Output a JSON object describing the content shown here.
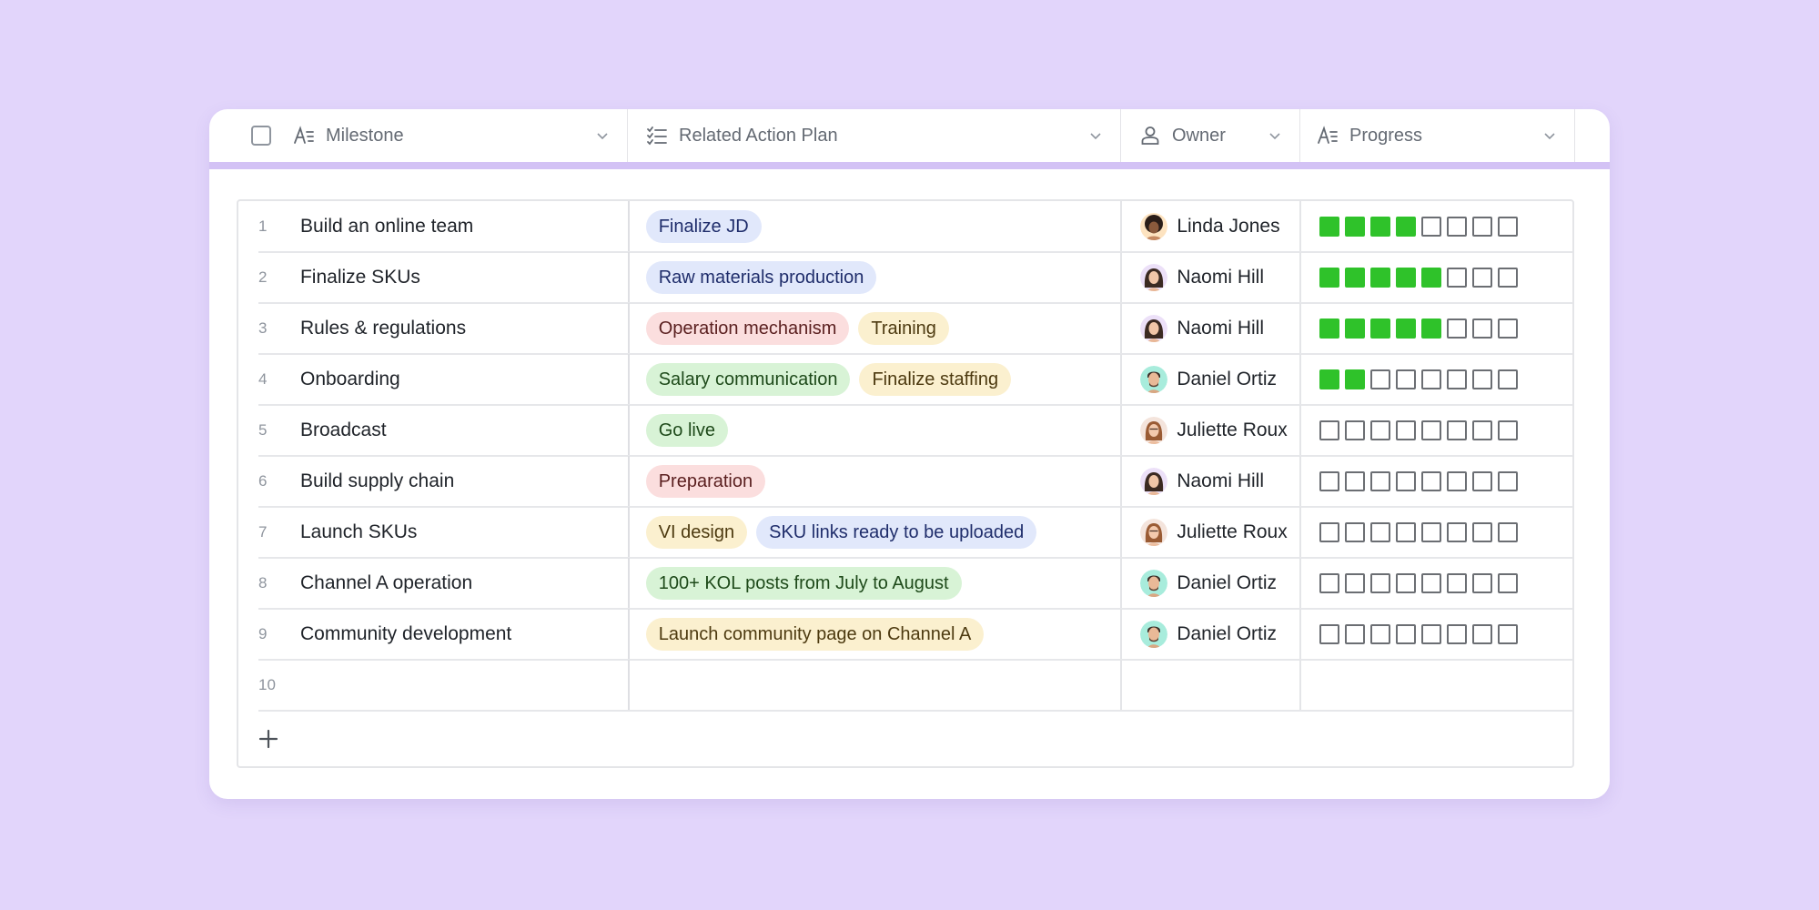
{
  "header": {
    "columns": [
      {
        "label": "Milestone",
        "icon": "text-field-icon"
      },
      {
        "label": "Related Action Plan",
        "icon": "checklist-icon"
      },
      {
        "label": "Owner",
        "icon": "person-icon"
      },
      {
        "label": "Progress",
        "icon": "text-field-icon"
      }
    ]
  },
  "colors": {
    "progress_filled": "#2fc22a",
    "background": "#e2d5fb",
    "tag_blue": "#e1e8fb",
    "tag_red": "#fbdede",
    "tag_yellow": "#fbf0cf",
    "tag_green": "#d8f3d6"
  },
  "progress_scale": 8,
  "rows": [
    {
      "num": "1",
      "milestone": "Build an online team",
      "actions": [
        {
          "label": "Finalize JD",
          "color": "blue"
        }
      ],
      "owner": "Linda Jones",
      "avatar": "linda",
      "progress": 4
    },
    {
      "num": "2",
      "milestone": "Finalize SKUs",
      "actions": [
        {
          "label": "Raw materials production",
          "color": "blue"
        }
      ],
      "owner": "Naomi Hill",
      "avatar": "naomi",
      "progress": 5
    },
    {
      "num": "3",
      "milestone": "Rules & regulations",
      "actions": [
        {
          "label": "Operation mechanism",
          "color": "red"
        },
        {
          "label": "Training",
          "color": "yellow"
        }
      ],
      "owner": "Naomi Hill",
      "avatar": "naomi",
      "progress": 5
    },
    {
      "num": "4",
      "milestone": "Onboarding",
      "actions": [
        {
          "label": "Salary communication",
          "color": "green"
        },
        {
          "label": "Finalize staffing",
          "color": "yellow"
        }
      ],
      "owner": "Daniel Ortiz",
      "avatar": "daniel",
      "progress": 2
    },
    {
      "num": "5",
      "milestone": "Broadcast",
      "actions": [
        {
          "label": "Go live",
          "color": "green"
        }
      ],
      "owner": "Juliette Roux",
      "avatar": "juliette",
      "progress": 0
    },
    {
      "num": "6",
      "milestone": "Build supply chain",
      "actions": [
        {
          "label": "Preparation",
          "color": "red"
        }
      ],
      "owner": "Naomi Hill",
      "avatar": "naomi",
      "progress": 0
    },
    {
      "num": "7",
      "milestone": "Launch SKUs",
      "actions": [
        {
          "label": "VI design",
          "color": "yellow"
        },
        {
          "label": "SKU links ready to be uploaded",
          "color": "blue"
        }
      ],
      "owner": "Juliette Roux",
      "avatar": "juliette",
      "progress": 0
    },
    {
      "num": "8",
      "milestone": "Channel A operation",
      "actions": [
        {
          "label": "100+ KOL posts from July to August",
          "color": "green"
        }
      ],
      "owner": "Daniel Ortiz",
      "avatar": "daniel",
      "progress": 0
    },
    {
      "num": "9",
      "milestone": "Community development",
      "actions": [
        {
          "label": "Launch community page on Channel A",
          "color": "yellow"
        }
      ],
      "owner": "Daniel Ortiz",
      "avatar": "daniel",
      "progress": 0
    },
    {
      "num": "10",
      "milestone": "",
      "actions": [],
      "owner": "",
      "avatar": "",
      "progress": null
    }
  ],
  "add_row_label": "+"
}
